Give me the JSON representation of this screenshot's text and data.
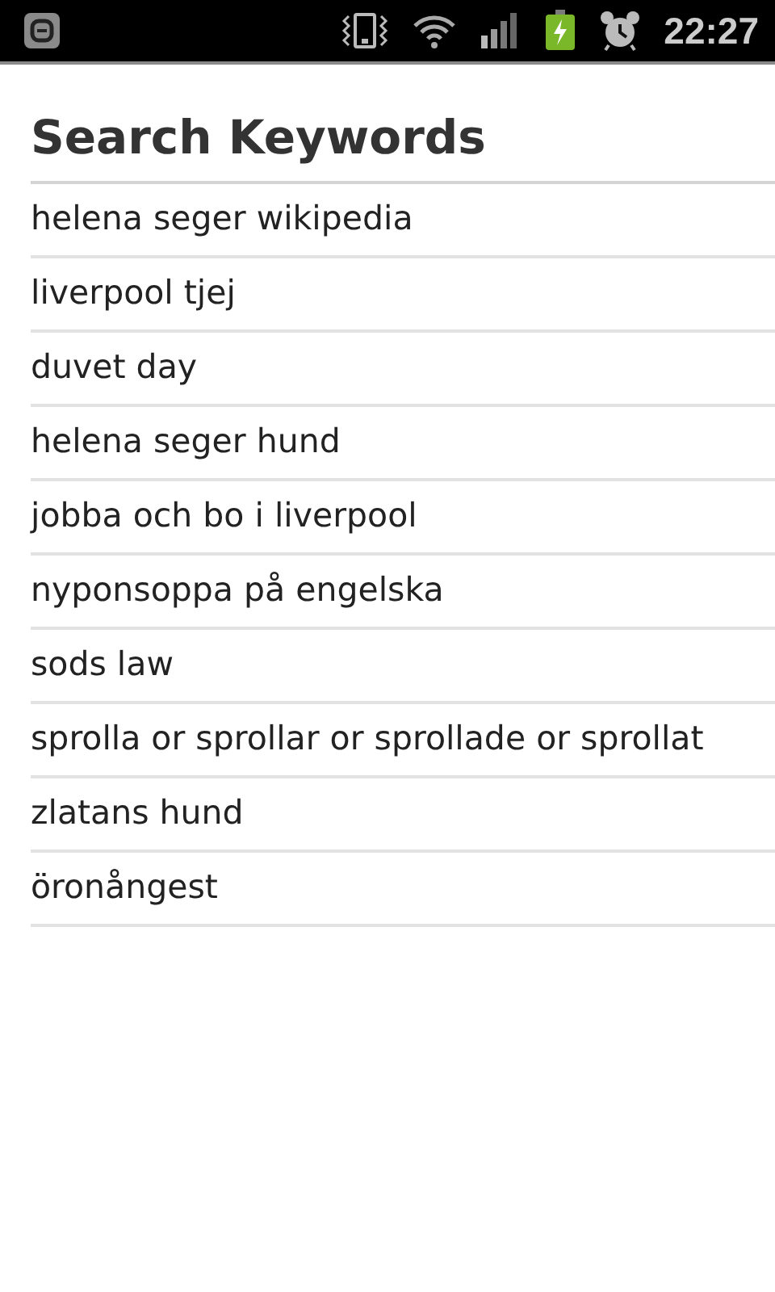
{
  "status_bar": {
    "time": "22:27"
  },
  "title": "Search Keywords",
  "keywords": [
    "helena seger wikipedia",
    "liverpool tjej",
    "duvet day",
    "helena seger hund",
    "jobba och bo i liverpool",
    "nyponsoppa på engelska",
    "sods law",
    "sprolla or sprollar or sprollade or sprollat",
    "zlatans hund",
    "öronångest"
  ]
}
